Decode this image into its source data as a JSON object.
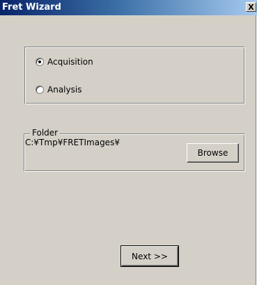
{
  "window": {
    "title": "Fret Wizard",
    "close_label": "X"
  },
  "mode": {
    "options": [
      {
        "label": "Acquisition",
        "selected": true
      },
      {
        "label": "Analysis",
        "selected": false
      }
    ]
  },
  "folder": {
    "legend": "Folder",
    "path": "C:¥Tmp¥FRETImages¥",
    "browse_label": "Browse"
  },
  "footer": {
    "next_label": "Next >>"
  },
  "colors": {
    "dialog_bg": "#d4d0c8",
    "titlebar_start": "#0a246a",
    "titlebar_end": "#a6caf0"
  }
}
